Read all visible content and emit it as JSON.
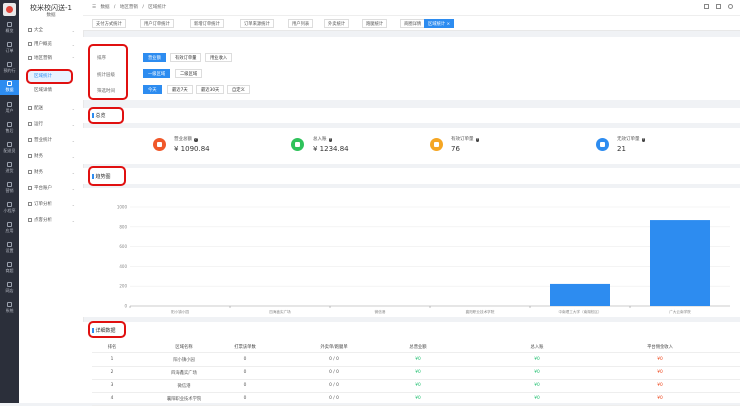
{
  "app": {
    "title": "校米校闪送-1",
    "subtitle": "数据"
  },
  "rail": [
    {
      "label": "概览",
      "icon": "home-icon"
    },
    {
      "label": "订单",
      "icon": "order-icon"
    },
    {
      "label": "预约行",
      "icon": "calendar-icon"
    },
    {
      "label": "数据",
      "icon": "chart-icon",
      "active": true
    },
    {
      "label": "用户",
      "icon": "user-icon"
    },
    {
      "label": "售后",
      "icon": "headset-icon"
    },
    {
      "label": "配送员",
      "icon": "courier-icon"
    },
    {
      "label": "进货",
      "icon": "cart-icon"
    },
    {
      "label": "营销",
      "icon": "gift-icon"
    },
    {
      "label": "小程序",
      "icon": "mini-program-icon"
    },
    {
      "label": "应用",
      "icon": "apps-icon"
    },
    {
      "label": "设置",
      "icon": "gear-icon"
    },
    {
      "label": "商超",
      "icon": "shop-icon"
    },
    {
      "label": "网店",
      "icon": "store-icon"
    },
    {
      "label": "系统",
      "icon": "system-icon"
    }
  ],
  "sidebar": {
    "items": [
      {
        "label": "大全"
      },
      {
        "label": "用户概览"
      },
      {
        "label": "地区营销"
      }
    ],
    "subitems": [
      {
        "label": "区域统计",
        "active": true
      },
      {
        "label": "区域详情"
      }
    ],
    "items2": [
      {
        "label": "配送"
      },
      {
        "label": "运行"
      },
      {
        "label": "营业统计"
      },
      {
        "label": "财务"
      },
      {
        "label": "财务"
      },
      {
        "label": "平台账户"
      },
      {
        "label": "订单分析"
      },
      {
        "label": "点客分析"
      }
    ]
  },
  "topbar": {
    "crumbs": [
      "数据",
      "/",
      "地区营销",
      "/",
      "区域统计"
    ]
  },
  "tabs": [
    {
      "label": "支付方式统计"
    },
    {
      "label": "用户订单统计"
    },
    {
      "label": "新增订单统计"
    },
    {
      "label": "订单来源统计"
    },
    {
      "label": "用户列表"
    },
    {
      "label": "外卖统计"
    },
    {
      "label": "跑腿统计"
    },
    {
      "label": "商圈详情"
    },
    {
      "label": "区域统计 ×",
      "active": true
    }
  ],
  "filters": {
    "sort": {
      "label": "排序",
      "options": [
        "营业额",
        "有效订单量",
        "用业收入"
      ]
    },
    "stat_dim": {
      "label": "统计层级",
      "options": [
        "一级区域",
        "二级区域"
      ]
    },
    "time": {
      "label": "筛选时间",
      "options": [
        "今天",
        "最近7天",
        "最近30天",
        "自定义"
      ]
    }
  },
  "overview": {
    "title": "总览",
    "stats": [
      {
        "label": "营业总额",
        "value": "¥ 1090.84",
        "color": "#f0582a",
        "icon": "wallet-icon"
      },
      {
        "label": "总入账",
        "value": "¥ 1234.84",
        "color": "#2fc25b",
        "icon": "income-icon"
      },
      {
        "label": "有效订单量",
        "value": "76",
        "color": "#f5a623",
        "icon": "lock-icon"
      },
      {
        "label": "无效订单量",
        "value": "21",
        "color": "#2d8cf0",
        "icon": "doc-icon"
      }
    ]
  },
  "chart_section": {
    "title": "趋势图"
  },
  "chart_data": {
    "type": "bar",
    "categories": [
      "阳小镇小园",
      "四海鑫实广场",
      "微信港",
      "襄阳职业技术学院",
      "中南理工大学（南湖校区）",
      "广大云南学院"
    ],
    "values": [
      0,
      0,
      0,
      0,
      223,
      868
    ],
    "yticks": [
      "0",
      "200",
      "400",
      "600",
      "800",
      "1000"
    ],
    "ylim": [
      0,
      1000
    ],
    "color": "#2d8cf0"
  },
  "table": {
    "title": "详细数据",
    "headers": [
      "排名",
      "区域名称",
      "打票该单数",
      "外卖单/跑腿单",
      "总营业额",
      "总入账",
      "平台佣金收入"
    ],
    "rows": [
      [
        "1",
        "阳小镇小园",
        "0",
        "0 / 0",
        "¥0",
        "¥0",
        "¥0"
      ],
      [
        "2",
        "四海鑫实广场",
        "0",
        "0 / 0",
        "¥0",
        "¥0",
        "¥0"
      ],
      [
        "3",
        "微信港",
        "0",
        "0 / 0",
        "¥0",
        "¥0",
        "¥0"
      ],
      [
        "4",
        "襄阳职业技术学院",
        "0",
        "0 / 0",
        "¥0",
        "¥0",
        "¥0"
      ]
    ]
  }
}
